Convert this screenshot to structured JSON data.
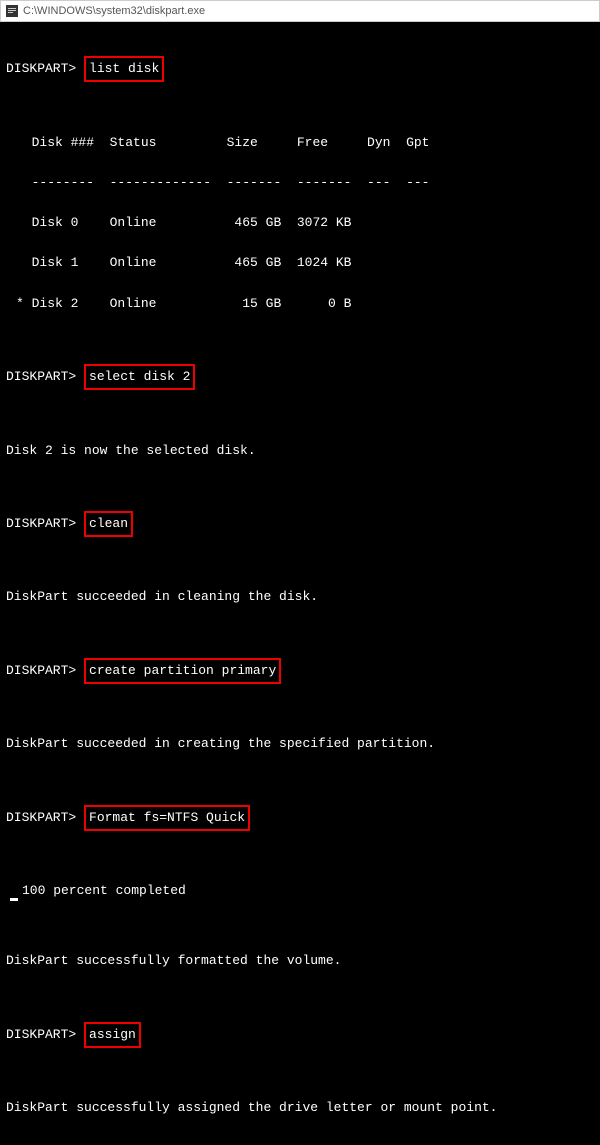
{
  "window": {
    "title": "C:\\WINDOWS\\system32\\diskpart.exe"
  },
  "prompt": "DISKPART>",
  "commands": {
    "list_disk": "list disk",
    "select_disk": "select disk 2",
    "clean": "clean",
    "create_partition": "create partition primary",
    "format": "Format fs=NTFS Quick",
    "assign": "assign"
  },
  "table": {
    "header": "  Disk ###  Status         Size     Free     Dyn  Gpt",
    "divider": "  --------  -------------  -------  -------  ---  ---",
    "rows": [
      "  Disk 0    Online          465 GB  3072 KB",
      "  Disk 1    Online          465 GB  1024 KB",
      "* Disk 2    Online           15 GB      0 B"
    ]
  },
  "messages": {
    "selected": "Disk 2 is now the selected disk.",
    "clean_ok": "DiskPart succeeded in cleaning the disk.",
    "partition_ok": "DiskPart succeeded in creating the specified partition.",
    "percent": "100 percent completed",
    "format_ok": "DiskPart successfully formatted the volume.",
    "assign_ok": "DiskPart successfully assigned the drive letter or mount point."
  }
}
